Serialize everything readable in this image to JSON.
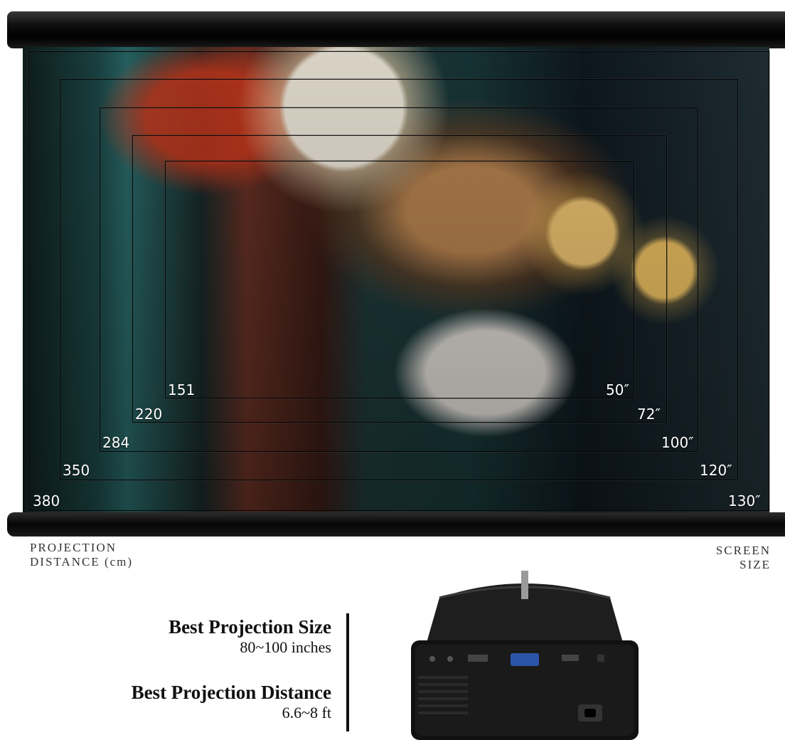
{
  "frames": [
    {
      "distance": "380",
      "size": "130″"
    },
    {
      "distance": "350",
      "size": "120″"
    },
    {
      "distance": "284",
      "size": "100″"
    },
    {
      "distance": "220",
      "size": "72″"
    },
    {
      "distance": "151",
      "size": "50″"
    }
  ],
  "captions": {
    "distance_line1": "PROJECTION",
    "distance_line2": "DISTANCE (cm)",
    "size_line1": "SCREEN",
    "size_line2": "SIZE"
  },
  "specs": {
    "size_title": "Best Projection Size",
    "size_value": "80~100 inches",
    "distance_title": "Best Projection Distance",
    "distance_value": "6.6~8 ft"
  },
  "colors": {
    "screen_bar": "#000000",
    "label_text": "#ffffff",
    "spec_text": "#111111"
  }
}
